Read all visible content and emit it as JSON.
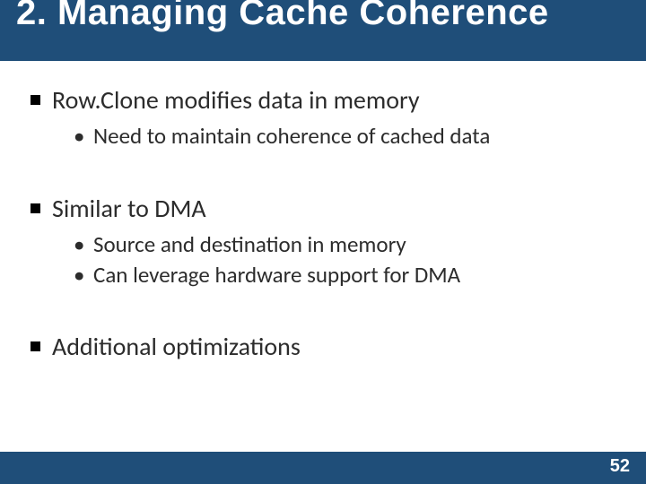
{
  "title": "2. Managing Cache Coherence",
  "bullets": [
    {
      "text": "Row.Clone modifies data in memory",
      "sub": [
        "Need to maintain coherence of cached data"
      ]
    },
    {
      "text": "Similar to DMA",
      "sub": [
        "Source and destination in memory",
        "Can leverage hardware support for DMA"
      ]
    },
    {
      "text": "Additional optimizations",
      "sub": []
    }
  ],
  "page_number": "52"
}
